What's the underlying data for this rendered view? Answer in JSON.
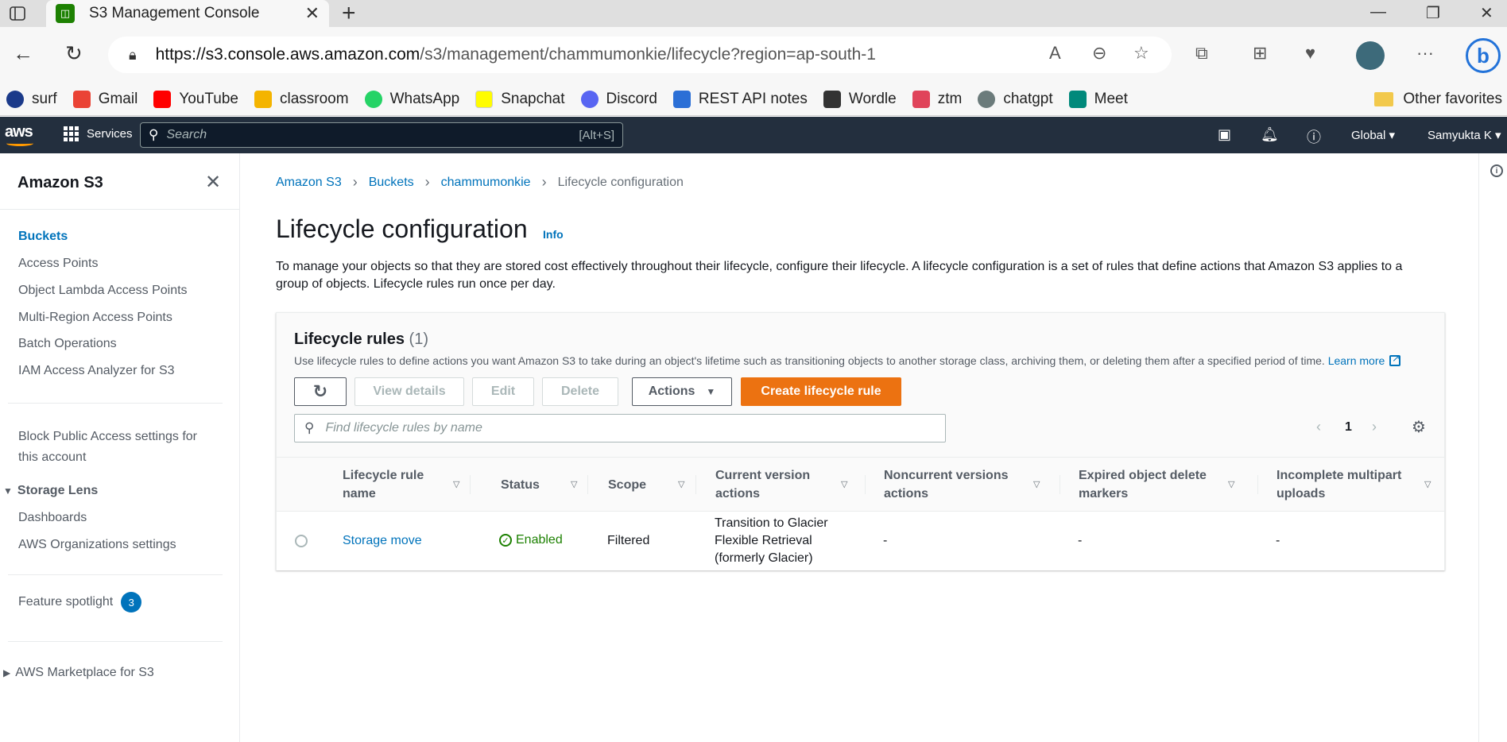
{
  "browser": {
    "tab_title": "S3 Management Console",
    "url_host": "https://s3.console.aws.amazon.com",
    "url_path": "/s3/management/chammumonkie/lifecycle?region=ap-south-1",
    "bookmarks": [
      {
        "label": "surf",
        "color": "#1b3a8a"
      },
      {
        "label": "Gmail",
        "color": "#ea4335"
      },
      {
        "label": "YouTube",
        "color": "#ff0000"
      },
      {
        "label": "classroom",
        "color": "#f4b400"
      },
      {
        "label": "WhatsApp",
        "color": "#25d366"
      },
      {
        "label": "Snapchat",
        "color": "#fffc00"
      },
      {
        "label": "Discord",
        "color": "#5865f2"
      },
      {
        "label": "REST API notes",
        "color": "#2b6fd6"
      },
      {
        "label": "Wordle",
        "color": "#333333"
      },
      {
        "label": "ztm",
        "color": "#e0435a"
      },
      {
        "label": "chatgpt",
        "color": "#6b7b7b"
      },
      {
        "label": "Meet",
        "color": "#00897b"
      }
    ],
    "other_favorites": "Other favorites"
  },
  "aws_nav": {
    "logo": "aws",
    "services": "Services",
    "search_placeholder": "Search",
    "search_shortcut": "[Alt+S]",
    "region": "Global",
    "user": "Samyukta K"
  },
  "sidebar": {
    "title": "Amazon S3",
    "items": [
      {
        "label": "Buckets"
      },
      {
        "label": "Access Points"
      },
      {
        "label": "Object Lambda Access Points"
      },
      {
        "label": "Multi-Region Access Points"
      },
      {
        "label": "Batch Operations"
      },
      {
        "label": "IAM Access Analyzer for S3"
      }
    ],
    "block_public_line1": "Block Public Access settings for",
    "block_public_line2": "this account",
    "storage_lens": "Storage Lens",
    "storage_lens_items": [
      "Dashboards",
      "AWS Organizations settings"
    ],
    "feature_spotlight": "Feature spotlight",
    "feature_spotlight_count": "3",
    "marketplace": "AWS Marketplace for S3"
  },
  "breadcrumb": [
    "Amazon S3",
    "Buckets",
    "chammumonkie",
    "Lifecycle configuration"
  ],
  "page": {
    "title": "Lifecycle configuration",
    "info": "Info",
    "description": "To manage your objects so that they are stored cost effectively throughout their lifecycle, configure their lifecycle. A lifecycle configuration is a set of rules that define actions that Amazon S3 applies to a group of objects. Lifecycle rules run once per day."
  },
  "rules_panel": {
    "title": "Lifecycle rules",
    "count": "(1)",
    "description": "Use lifecycle rules to define actions you want Amazon S3 to take during an object's lifetime such as transitioning objects to another storage class, archiving them, or deleting them after a specified period of time.",
    "learn_more": "Learn more",
    "buttons": {
      "view_details": "View details",
      "edit": "Edit",
      "delete": "Delete",
      "actions": "Actions",
      "create": "Create lifecycle rule"
    },
    "filter_placeholder": "Find lifecycle rules by name",
    "page_number": "1",
    "columns": [
      {
        "line1": "Lifecycle rule",
        "line2": "name"
      },
      {
        "line1": "Status",
        "line2": ""
      },
      {
        "line1": "Scope",
        "line2": ""
      },
      {
        "line1": "Current version",
        "line2": "actions"
      },
      {
        "line1": "Noncurrent versions",
        "line2": "actions"
      },
      {
        "line1": "Expired object delete",
        "line2": "markers"
      },
      {
        "line1": "Incomplete multipart",
        "line2": "uploads"
      }
    ],
    "rows": [
      {
        "name": "Storage move",
        "status": "Enabled",
        "scope": "Filtered",
        "current_actions": [
          "Transition to Glacier",
          "Flexible Retrieval",
          "(formerly Glacier)"
        ],
        "noncurrent_actions": "-",
        "expired_markers": "-",
        "incomplete_uploads": "-"
      }
    ]
  }
}
